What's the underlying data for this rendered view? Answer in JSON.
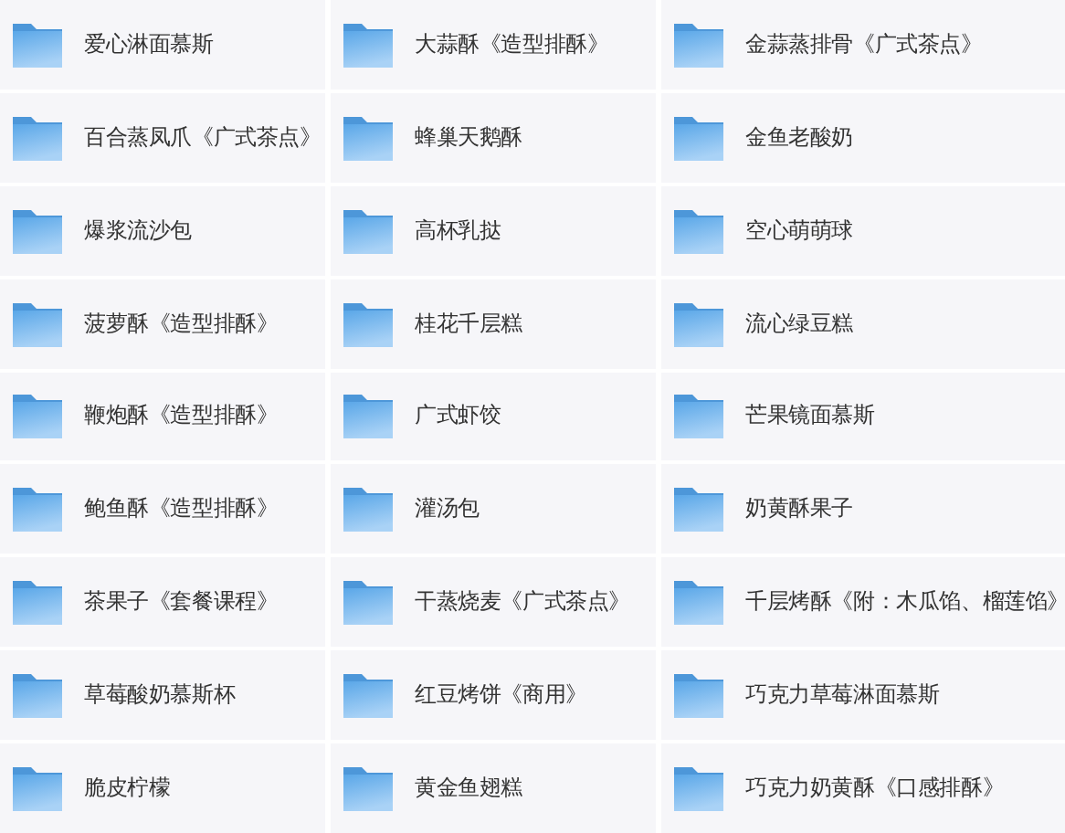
{
  "folders": [
    {
      "name": "爱心淋面慕斯"
    },
    {
      "name": "大蒜酥《造型排酥》"
    },
    {
      "name": "金蒜蒸排骨《广式茶点》"
    },
    {
      "name": "百合蒸凤爪《广式茶点》"
    },
    {
      "name": "蜂巢天鹅酥"
    },
    {
      "name": "金鱼老酸奶"
    },
    {
      "name": "爆浆流沙包"
    },
    {
      "name": "高杯乳挞"
    },
    {
      "name": "空心萌萌球"
    },
    {
      "name": "菠萝酥《造型排酥》"
    },
    {
      "name": "桂花千层糕"
    },
    {
      "name": "流心绿豆糕"
    },
    {
      "name": "鞭炮酥《造型排酥》"
    },
    {
      "name": "广式虾饺"
    },
    {
      "name": "芒果镜面慕斯"
    },
    {
      "name": "鲍鱼酥《造型排酥》"
    },
    {
      "name": "灌汤包"
    },
    {
      "name": "奶黄酥果子"
    },
    {
      "name": "茶果子《套餐课程》"
    },
    {
      "name": "干蒸烧麦《广式茶点》"
    },
    {
      "name": "千层烤酥《附：木瓜馅、榴莲馅》"
    },
    {
      "name": "草莓酸奶慕斯杯"
    },
    {
      "name": "红豆烤饼《商用》"
    },
    {
      "name": "巧克力草莓淋面慕斯"
    },
    {
      "name": "脆皮柠檬"
    },
    {
      "name": "黄金鱼翅糕"
    },
    {
      "name": "巧克力奶黄酥《口感排酥》"
    }
  ]
}
